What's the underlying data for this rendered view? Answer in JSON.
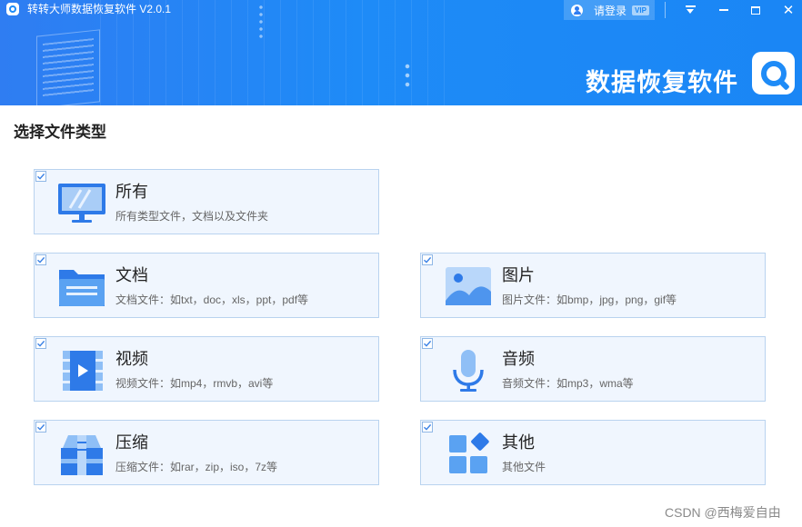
{
  "window": {
    "title": "转转大师数据恢复软件 V2.0.1",
    "login_label": "请登录",
    "vip_badge": "VIP"
  },
  "banner": {
    "text": "数据恢复软件"
  },
  "main": {
    "section_title": "选择文件类型",
    "cards": [
      {
        "title": "所有",
        "desc": "所有类型文件，文档以及文件夹",
        "checked": true,
        "icon": "monitor-icon"
      },
      {
        "title": "文档",
        "desc": "文档文件：如txt，doc，xls，ppt，pdf等",
        "checked": true,
        "icon": "folder-icon"
      },
      {
        "title": "图片",
        "desc": "图片文件：如bmp，jpg，png，gif等",
        "checked": true,
        "icon": "image-icon"
      },
      {
        "title": "视频",
        "desc": "视频文件：如mp4，rmvb，avi等",
        "checked": true,
        "icon": "video-icon"
      },
      {
        "title": "音频",
        "desc": "音频文件：如mp3，wma等",
        "checked": true,
        "icon": "microphone-icon"
      },
      {
        "title": "压缩",
        "desc": "压缩文件：如rar，zip，iso，7z等",
        "checked": true,
        "icon": "archive-icon"
      },
      {
        "title": "其他",
        "desc": "其他文件",
        "checked": true,
        "icon": "apps-icon"
      }
    ]
  },
  "watermark": "CSDN @西梅爱自由",
  "colors": {
    "accent": "#1e8bf7",
    "card_bg": "#f0f6fe",
    "card_border": "#b9d3ef"
  }
}
